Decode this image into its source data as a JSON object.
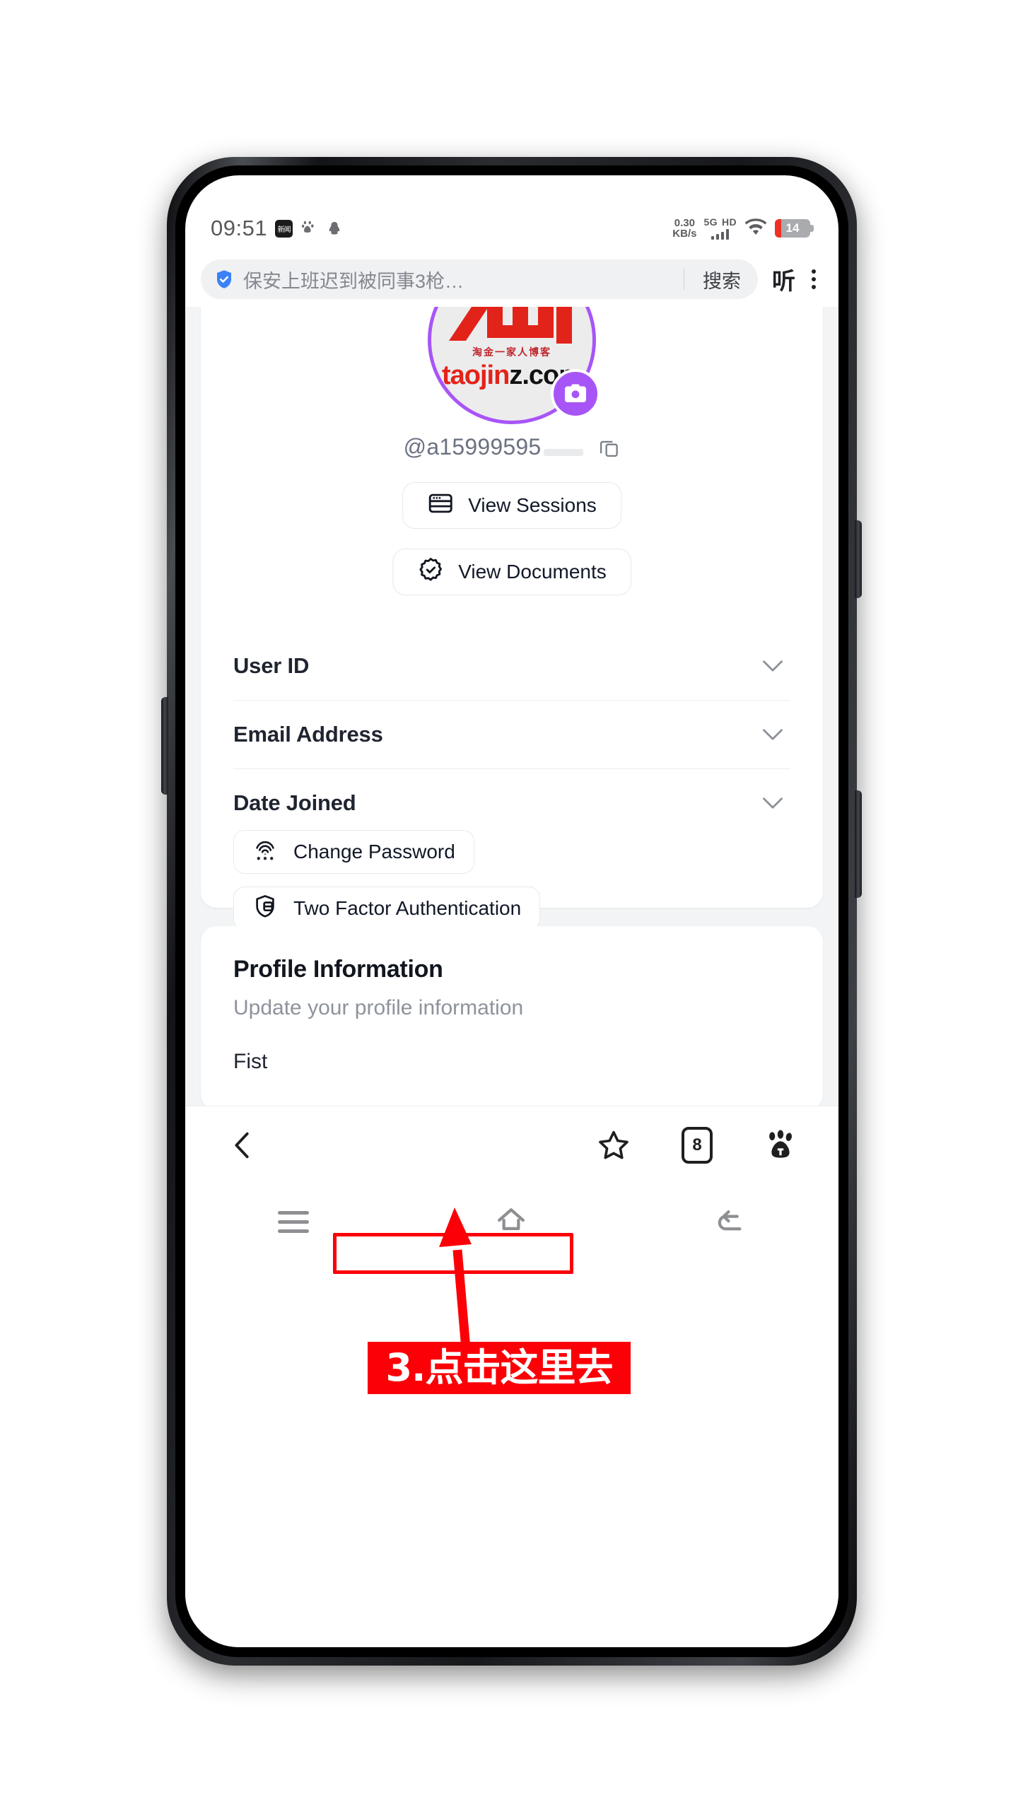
{
  "status_bar": {
    "time": "09:51",
    "icons_left": [
      "news-icon",
      "baidu-icon",
      "qq-icon"
    ],
    "net_speed_value": "0.30",
    "net_speed_unit": "KB/s",
    "network_type": "5G",
    "hd_label": "HD",
    "battery_percent": "14"
  },
  "browser": {
    "omnibox_text": "保安上班迟到被同事3枪…",
    "search_button": "搜索",
    "listen_button": "听",
    "menu_icon": "kebab-menu-icon",
    "bottom": {
      "back_icon": "chevron-left-icon",
      "bookmark_icon": "star-icon",
      "tab_count": "8",
      "home_icon": "baidu-paw-icon"
    }
  },
  "android_nav": {
    "menu_icon": "hamburger-icon",
    "home_icon": "home-icon",
    "back_icon": "back-arrow-icon"
  },
  "account_card": {
    "avatar": {
      "logo_subtitle": "淘金一家人博客",
      "domain_red": "taojin",
      "domain_black": "z.com",
      "camera_badge": "camera-icon"
    },
    "handle": "@a15999595",
    "copy_icon": "copy-icon",
    "buttons": [
      {
        "label": "View Sessions",
        "icon": "browser-window-icon"
      },
      {
        "label": "View Documents",
        "icon": "badge-check-icon"
      }
    ],
    "accordions": [
      {
        "label": "User ID",
        "icon": "chevron-down-icon"
      },
      {
        "label": "Email Address",
        "icon": "chevron-down-icon"
      },
      {
        "label": "Date Joined",
        "icon": "chevron-down-icon"
      }
    ],
    "security_buttons": [
      {
        "label": "Change Password",
        "icon": "fingerprint-password-icon"
      },
      {
        "label": "Two Factor Authentication",
        "icon": "shield-lock-icon"
      }
    ]
  },
  "profile_card": {
    "title": "Profile Information",
    "subtitle": "Update your profile information",
    "field_label": "Fist"
  },
  "annotation": {
    "text": "3.点击这里去",
    "color": "#fb0007",
    "highlight_target": "Two Factor Authentication"
  }
}
